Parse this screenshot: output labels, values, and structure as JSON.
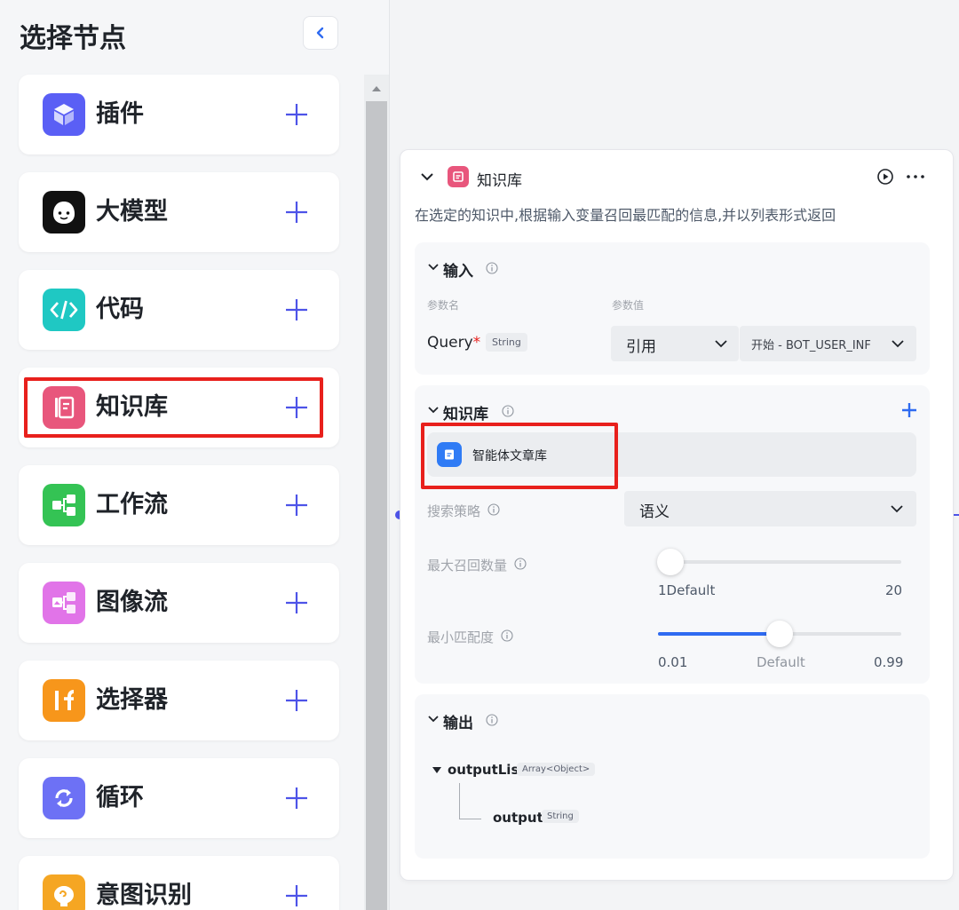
{
  "panel": {
    "title": "选择节点",
    "nodes": [
      {
        "label": "插件",
        "icon": "cube-icon",
        "color": "#5a5ff5"
      },
      {
        "label": "大模型",
        "icon": "robot-face-icon",
        "color": "#111111"
      },
      {
        "label": "代码",
        "icon": "code-brackets-icon",
        "color": "#1fc8c3"
      },
      {
        "label": "知识库",
        "icon": "document-list-icon",
        "color": "#e8567c"
      },
      {
        "label": "工作流",
        "icon": "flow-nodes-icon",
        "color": "#34c354"
      },
      {
        "label": "图像流",
        "icon": "image-flow-icon",
        "color": "#e174e8"
      },
      {
        "label": "选择器",
        "icon": "if-icon",
        "color": "#f7961b"
      },
      {
        "label": "循环",
        "icon": "loop-arrows-icon",
        "color": "#6d71f5"
      },
      {
        "label": "意图识别",
        "icon": "brain-icon",
        "color": "#f5a623"
      }
    ]
  },
  "node": {
    "title": "知识库",
    "icon_color": "#e8567c",
    "description": "在选定的知识中,根据输入变量召回最匹配的信息,并以列表形式返回",
    "input": {
      "title": "输入",
      "param_name_label": "参数名",
      "param_value_label": "参数值",
      "param": {
        "name": "Query",
        "required_mark": "*",
        "type": "String",
        "mode": "引用",
        "value": "开始 - BOT_USER_INF"
      }
    },
    "knowledge": {
      "title": "知识库",
      "item": "智能体文章库",
      "search_strategy_label": "搜索策略",
      "search_strategy_value": "语义",
      "max_recall": {
        "label": "最大召回数量",
        "min_label": "1",
        "default_label": "Default",
        "max_label": "20",
        "value_fraction": 0.05
      },
      "min_match": {
        "label": "最小匹配度",
        "min_label": "0.01",
        "default_label": "Default",
        "max_label": "0.99",
        "value_fraction": 0.5
      }
    },
    "output": {
      "title": "输出",
      "list_name": "outputList",
      "list_type": "Array<Object>",
      "child_name": "output",
      "child_type": "String"
    }
  },
  "colors": {
    "accent": "#4d53e8",
    "slider": "#2f6bf1",
    "highlight": "#e8201c"
  }
}
